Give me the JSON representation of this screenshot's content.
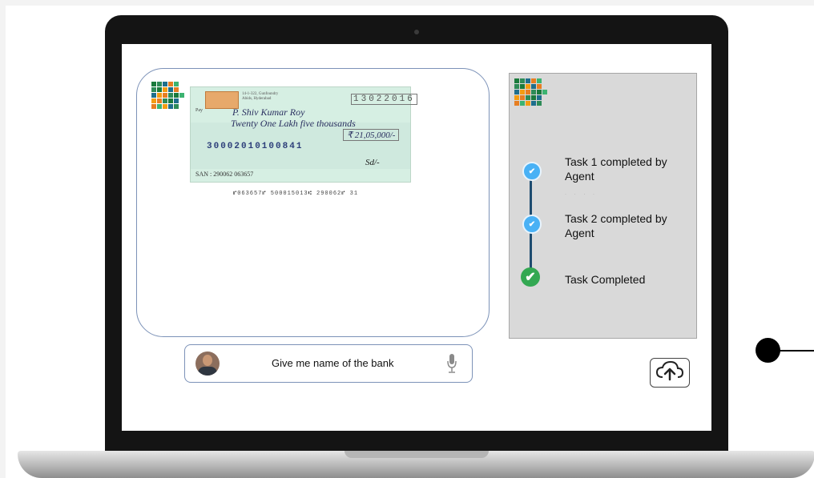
{
  "colors": {
    "accent": "#49b1f5",
    "success": "#33a852",
    "timeline": "#1e4c70",
    "panel": "#d9d9d9"
  },
  "logo_colors": [
    "#1a7a3c",
    "#2e8b57",
    "#f39c12",
    "#1e6e8c",
    "#e67e22",
    "#3cb371"
  ],
  "cheque": {
    "date": "13022016",
    "pay_label": "Pay",
    "payee": "P. Shiv Kumar Roy",
    "words": "Twenty One Lakh five thousands",
    "amount": "₹ 21,05,000/-",
    "account": "30002010100841",
    "san": "SAN : 290062 063657",
    "micr": "⑈063657⑈ 500015013⑆ 290062⑈ 31"
  },
  "tasks": [
    {
      "label": "Task 1  completed by Agent",
      "icon": "agent-check-icon"
    },
    {
      "label": "Task 2 completed by Agent",
      "icon": "agent-check-icon"
    },
    {
      "label": "Task Completed",
      "icon": "success-check-icon"
    }
  ],
  "prompt": {
    "text": "Give me name of the bank",
    "icon": "microphone-icon"
  },
  "upload": {
    "icon": "cloud-upload-icon"
  }
}
